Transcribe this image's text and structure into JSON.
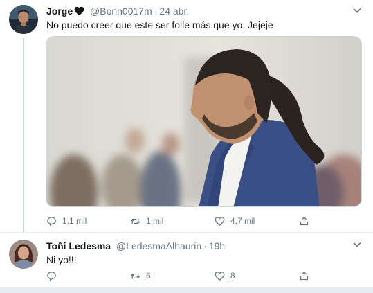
{
  "tweets": [
    {
      "author_name": "Jorge",
      "author_emoji_icon": "black-heart-icon",
      "handle": "@Bonn0017m",
      "separator": "·",
      "time": "24 abr.",
      "text": "No puedo creer que este ser folle más que yo. Jejeje",
      "media_icon": "photo-of-long-haired-man-in-blue-blazer",
      "reply_count": "1,1 mil",
      "retweet_count": "1 mil",
      "like_count": "4,7 mil"
    },
    {
      "author_name": "Toñi Ledesma",
      "handle": "@LedesmaAlhaurin",
      "separator": "·",
      "time": "19h",
      "text": "Ni yo!!!",
      "reply_count": "",
      "retweet_count": "6",
      "like_count": "8"
    }
  ],
  "colors": {
    "primary_text": "#14171a",
    "secondary_text": "#657786",
    "border": "#e6ecf0",
    "thread_line": "#ccd6dd"
  }
}
